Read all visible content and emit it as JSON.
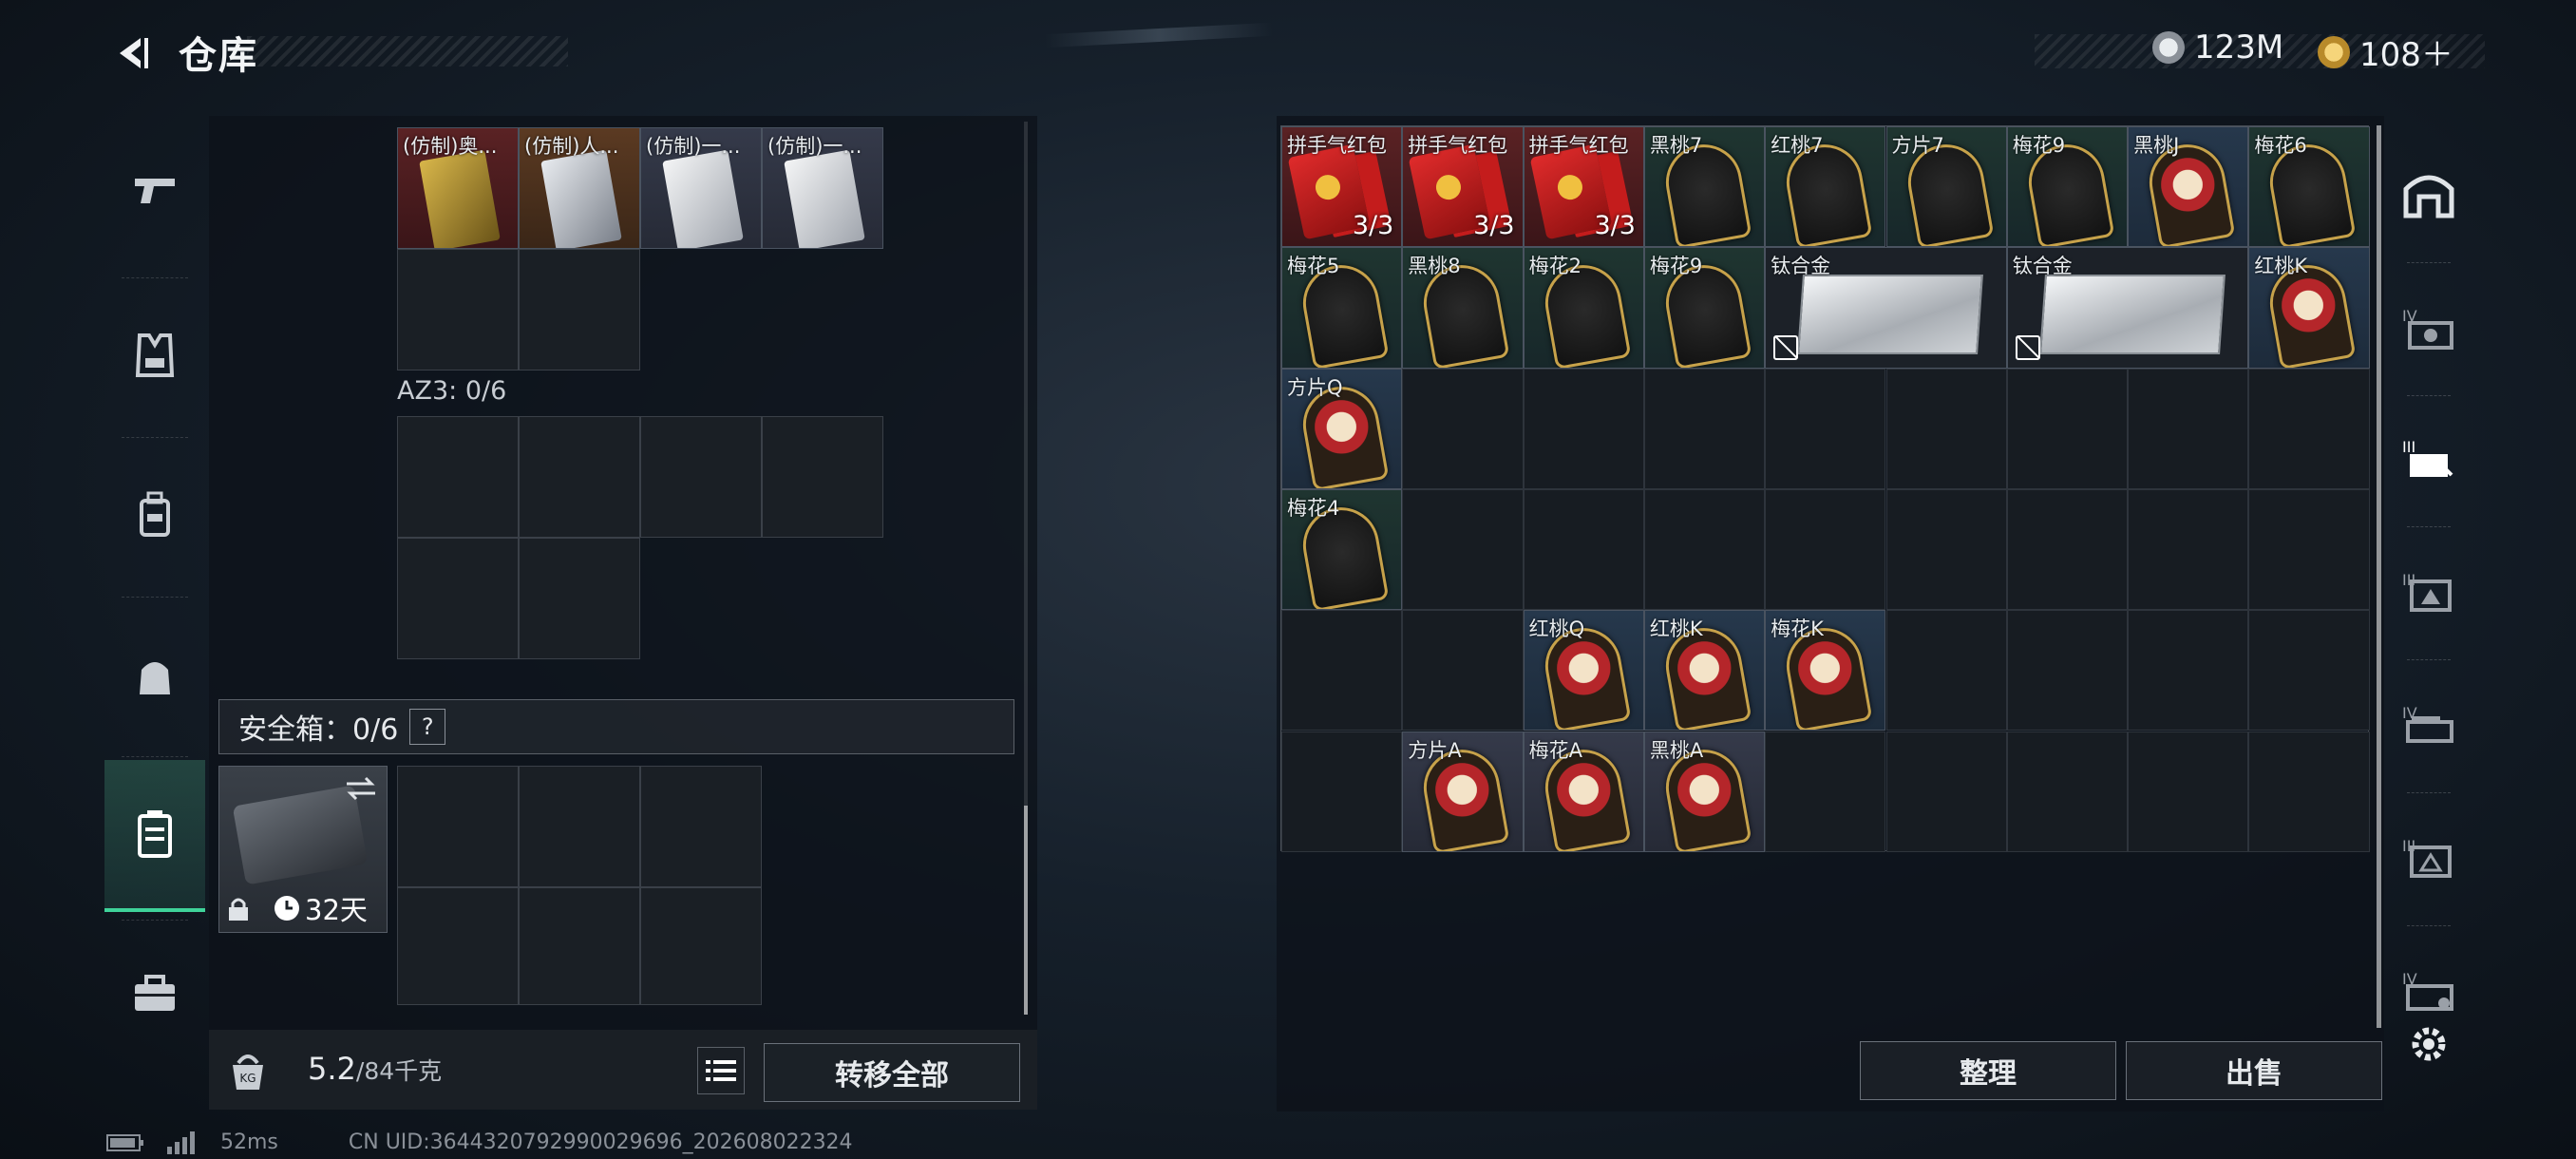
{
  "header": {
    "title": "仓库",
    "currency1": "123M",
    "currency2": "108＋"
  },
  "left": {
    "top_items": [
      {
        "label": "(仿制)奥...",
        "rarity": "red"
      },
      {
        "label": "(仿制)人...",
        "rarity": "orange"
      },
      {
        "label": "(仿制)一...",
        "rarity": "purple"
      },
      {
        "label": "(仿制)一...",
        "rarity": "purple"
      }
    ],
    "az3_label": "AZ3: 0/6",
    "safe_label": "安全箱：0/6",
    "safe_help": "?",
    "safe_days": "32天"
  },
  "bottom": {
    "weight_current": "5.2",
    "weight_max": "/84千克",
    "kg_icon": "KG",
    "transfer_all": "转移全部",
    "organize": "整理",
    "sell": "出售"
  },
  "status": {
    "ping": "52ms",
    "uid": "CN UID:3644320792990029696_202608022324"
  },
  "stash": {
    "row1": [
      {
        "label": "拼手气红包",
        "count": "3/3",
        "kind": "envelope",
        "bg": "red"
      },
      {
        "label": "拼手气红包",
        "count": "3/3",
        "kind": "envelope",
        "bg": "red"
      },
      {
        "label": "拼手气红包",
        "count": "3/3",
        "kind": "envelope",
        "bg": "red"
      },
      {
        "label": "黑桃7",
        "kind": "dark",
        "bg": "green"
      },
      {
        "label": "红桃7",
        "kind": "dark",
        "bg": "green"
      },
      {
        "label": "方片7",
        "kind": "dark",
        "bg": "green"
      },
      {
        "label": "梅花9",
        "kind": "dark",
        "bg": "green"
      },
      {
        "label": "黑桃J",
        "kind": "face",
        "bg": "blue"
      },
      {
        "label": "梅花6",
        "kind": "dark",
        "bg": "green"
      }
    ],
    "row2_left": [
      {
        "label": "梅花5",
        "kind": "dark",
        "bg": "green"
      },
      {
        "label": "黑桃8",
        "kind": "dark",
        "bg": "green"
      },
      {
        "label": "梅花2",
        "kind": "dark",
        "bg": "green"
      },
      {
        "label": "梅花9",
        "kind": "dark",
        "bg": "green"
      }
    ],
    "ingots": [
      {
        "label": "钛合金"
      },
      {
        "label": "钛合金"
      }
    ],
    "row2_right": {
      "label": "红桃K",
      "kind": "face",
      "bg": "blue"
    },
    "col_items": [
      {
        "label": "方片Q",
        "kind": "face",
        "bg": "blue",
        "row": 2
      },
      {
        "label": "梅花4",
        "kind": "dark",
        "bg": "green",
        "row": 3
      }
    ],
    "row5": [
      {
        "label": "红桃Q",
        "kind": "face",
        "bg": "blue"
      },
      {
        "label": "红桃K",
        "kind": "face",
        "bg": "blue"
      },
      {
        "label": "梅花K",
        "kind": "face",
        "bg": "blue"
      }
    ],
    "row6": [
      {
        "label": "方片A",
        "kind": "face",
        "bg": "purple"
      },
      {
        "label": "梅花A",
        "kind": "face",
        "bg": "purple"
      },
      {
        "label": "黑桃A",
        "kind": "face",
        "bg": "purple"
      }
    ]
  }
}
